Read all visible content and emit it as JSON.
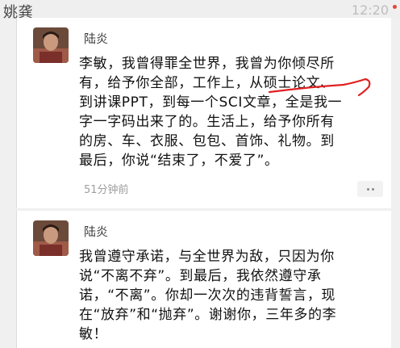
{
  "header": {
    "title": "姚龚",
    "time": "12:20"
  },
  "posts": [
    {
      "author": "陆炎",
      "lines": [
        "李敏，我曾得罪全世界，我曾为你倾尽所",
        "有，给予你全部，工作上，从硕士论文、",
        "到讲课PPT，到每一个SCI文章，全是我一",
        "字一字码出来了的。生活上，给予你所有",
        "的房、车、衣服、包包、首饰、礼物。到",
        "最后，你说“结束了，不爱了”。"
      ],
      "time": "51分钟前"
    },
    {
      "author": "陆炎",
      "lines": [
        "我曾遵守承诺，与全世界为敌，只因为你",
        "说“不离不弃”。到最后，我依然遵守承",
        "诺，“不离”。你却一次次的违背誓言，现",
        "在“放弃”和“抛弃”。谢谢你，三年多的李",
        "敏！"
      ]
    }
  ],
  "colors": {
    "annotation": "#e02020",
    "background": "#f0f0f0",
    "card": "#ffffff"
  }
}
